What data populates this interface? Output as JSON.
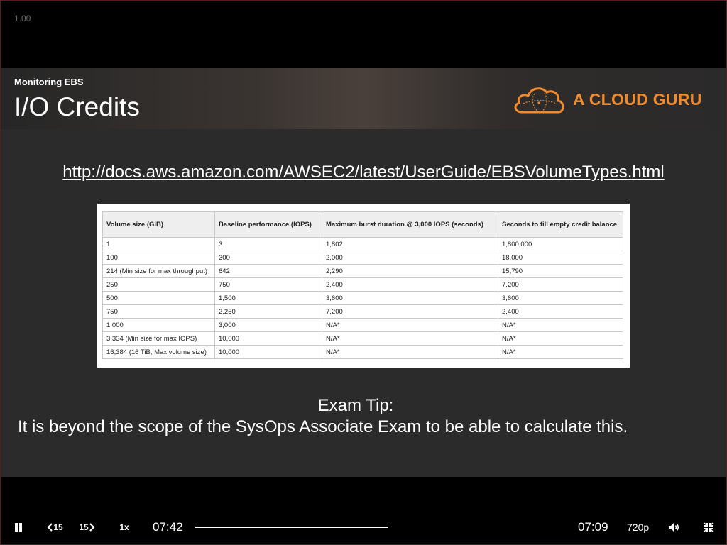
{
  "player": {
    "speed_overlay": "1.00",
    "rewind_label": "15",
    "forward_label": "15",
    "speed_label": "1x",
    "elapsed_time": "07:42",
    "remaining_time": "07:09",
    "quality": "720p",
    "progress_fraction": 1.0
  },
  "slide": {
    "section": "Monitoring EBS",
    "title": "I/O Credits",
    "logo_text": "A CLOUD GURU",
    "link": "http://docs.aws.amazon.com/AWSEC2/latest/UserGuide/EBSVolumeTypes.html",
    "tip_title": "Exam Tip:",
    "tip_text": "It is beyond the scope of the SysOps Associate Exam to be able to calculate this."
  },
  "table": {
    "headers": [
      "Volume size (GiB)",
      "Baseline performance (IOPS)",
      "Maximum burst duration @ 3,000 IOPS (seconds)",
      "Seconds to fill empty credit balance"
    ],
    "rows": [
      [
        "1",
        "3",
        "1,802",
        "1,800,000"
      ],
      [
        "100",
        "300",
        "2,000",
        "18,000"
      ],
      [
        "214 (Min size for max throughput)",
        "642",
        "2,290",
        "15,790"
      ],
      [
        "250",
        "750",
        "2,400",
        "7,200"
      ],
      [
        "500",
        "1,500",
        "3,600",
        "3,600"
      ],
      [
        "750",
        "2,250",
        "7,200",
        "2,400"
      ],
      [
        "1,000",
        "3,000",
        "N/A*",
        "N/A*"
      ],
      [
        "3,334 (Min size for max IOPS)",
        "10,000",
        "N/A*",
        "N/A*"
      ],
      [
        "16,384 (16 TiB, Max volume size)",
        "10,000",
        "N/A*",
        "N/A*"
      ]
    ]
  },
  "colors": {
    "brand": "#f08a2c",
    "slide_bg": "#2c2b2c",
    "player_bg": "#000000"
  },
  "icons": {
    "pause": "pause-icon",
    "rewind": "rewind-15-icon",
    "forward": "forward-15-icon",
    "volume": "volume-icon",
    "exit_fullscreen": "exit-fullscreen-icon",
    "logo": "cloud-logo-icon"
  }
}
